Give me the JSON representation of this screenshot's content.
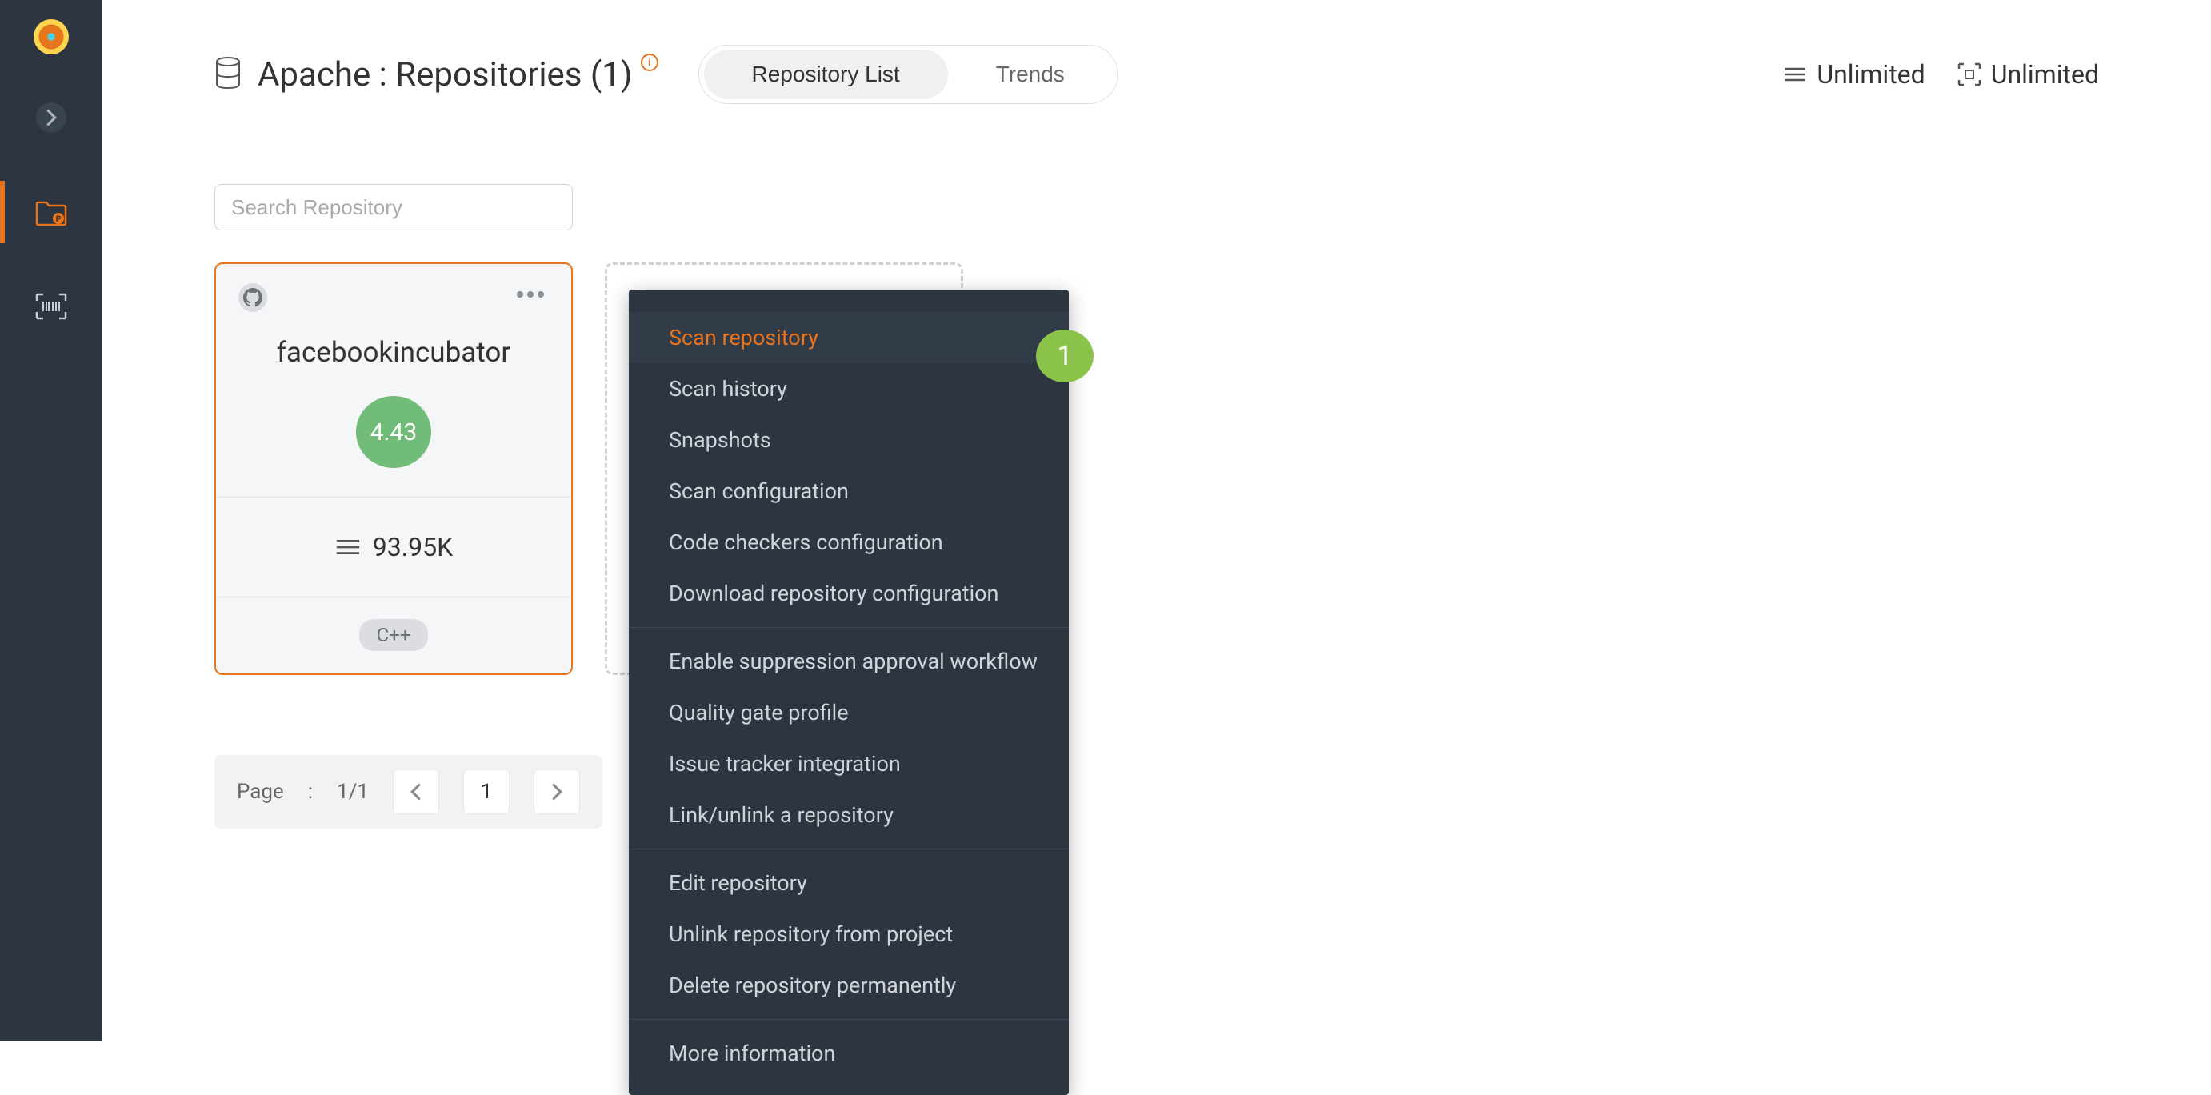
{
  "header": {
    "title": "Apache : Repositories (1)",
    "info_badge": "i",
    "tabs": {
      "list": "Repository List",
      "trends": "Trends"
    },
    "unlimited1": "Unlimited",
    "unlimited2": "Unlimited"
  },
  "search": {
    "placeholder": "Search Repository"
  },
  "repo": {
    "name": "facebookincubator",
    "score": "4.43",
    "lines": "93.95K",
    "language": "C++"
  },
  "menu": {
    "scan_repository": "Scan repository",
    "scan_history": "Scan history",
    "snapshots": "Snapshots",
    "scan_configuration": "Scan configuration",
    "code_checkers": "Code checkers configuration",
    "download_config": "Download repository configuration",
    "enable_suppression": "Enable suppression approval workflow",
    "quality_gate": "Quality gate profile",
    "issue_tracker": "Issue tracker integration",
    "link_unlink": "Link/unlink a repository",
    "edit_repo": "Edit repository",
    "unlink_repo": "Unlink repository from project",
    "delete_repo": "Delete repository permanently",
    "more_info": "More information"
  },
  "step_badge": "1",
  "pagination": {
    "label": "Page",
    "sep": ":",
    "of": "1/1",
    "current": "1"
  },
  "icons": {
    "chevron_right": "chevron-right-icon",
    "folder": "folder-icon",
    "barcode": "barcode-icon",
    "database": "database-icon",
    "lines": "lines-icon",
    "github": "github-icon",
    "dots": "more-dots-icon",
    "chevron_left": "chevron-left-icon",
    "qr": "qr-icon"
  },
  "colors": {
    "accent": "#e8741d",
    "green": "#71bc78",
    "step": "#8bc34a",
    "sidebar": "#2c3540"
  }
}
